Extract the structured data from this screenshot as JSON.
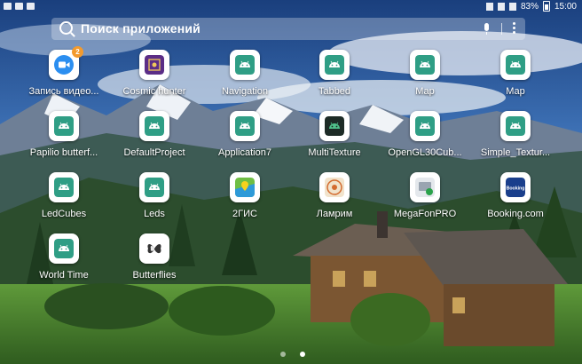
{
  "status_bar": {
    "battery": "83%",
    "time": "15:00"
  },
  "search": {
    "placeholder": "Поиск приложений"
  },
  "colors": {
    "android_teal": "#2f9e85",
    "badge": "#f39a2d",
    "search_bg": "rgba(255,255,255,0.28)"
  },
  "apps": [
    {
      "label": "Запись видео...",
      "icon": "video-camera-icon",
      "badge": "2"
    },
    {
      "label": "Cosmic hunter",
      "icon": "cosmic-hunter-icon"
    },
    {
      "label": "Navigation",
      "icon": "android-icon"
    },
    {
      "label": "Tabbed",
      "icon": "android-icon"
    },
    {
      "label": "Map",
      "icon": "android-icon"
    },
    {
      "label": "Map",
      "icon": "android-icon"
    },
    {
      "label": "Papilio butterf...",
      "icon": "android-icon"
    },
    {
      "label": "DefaultProject",
      "icon": "android-icon"
    },
    {
      "label": "Application7",
      "icon": "android-icon"
    },
    {
      "label": "MultiTexture",
      "icon": "android-dark-icon"
    },
    {
      "label": "OpenGL30Cub...",
      "icon": "android-icon"
    },
    {
      "label": "Simple_Textur...",
      "icon": "android-icon"
    },
    {
      "label": "LedCubes",
      "icon": "android-icon"
    },
    {
      "label": "Leds",
      "icon": "android-icon"
    },
    {
      "label": "2ГИС",
      "icon": "map-2gis-icon"
    },
    {
      "label": "Ламрим",
      "icon": "lamrim-icon"
    },
    {
      "label": "MegaFonPRO",
      "icon": "megafon-icon"
    },
    {
      "label": "Booking.com",
      "icon": "booking-icon",
      "icon_text": "Booking"
    },
    {
      "label": "World Time",
      "icon": "android-icon"
    },
    {
      "label": "Butterflies",
      "icon": "butterfly-icon"
    }
  ]
}
